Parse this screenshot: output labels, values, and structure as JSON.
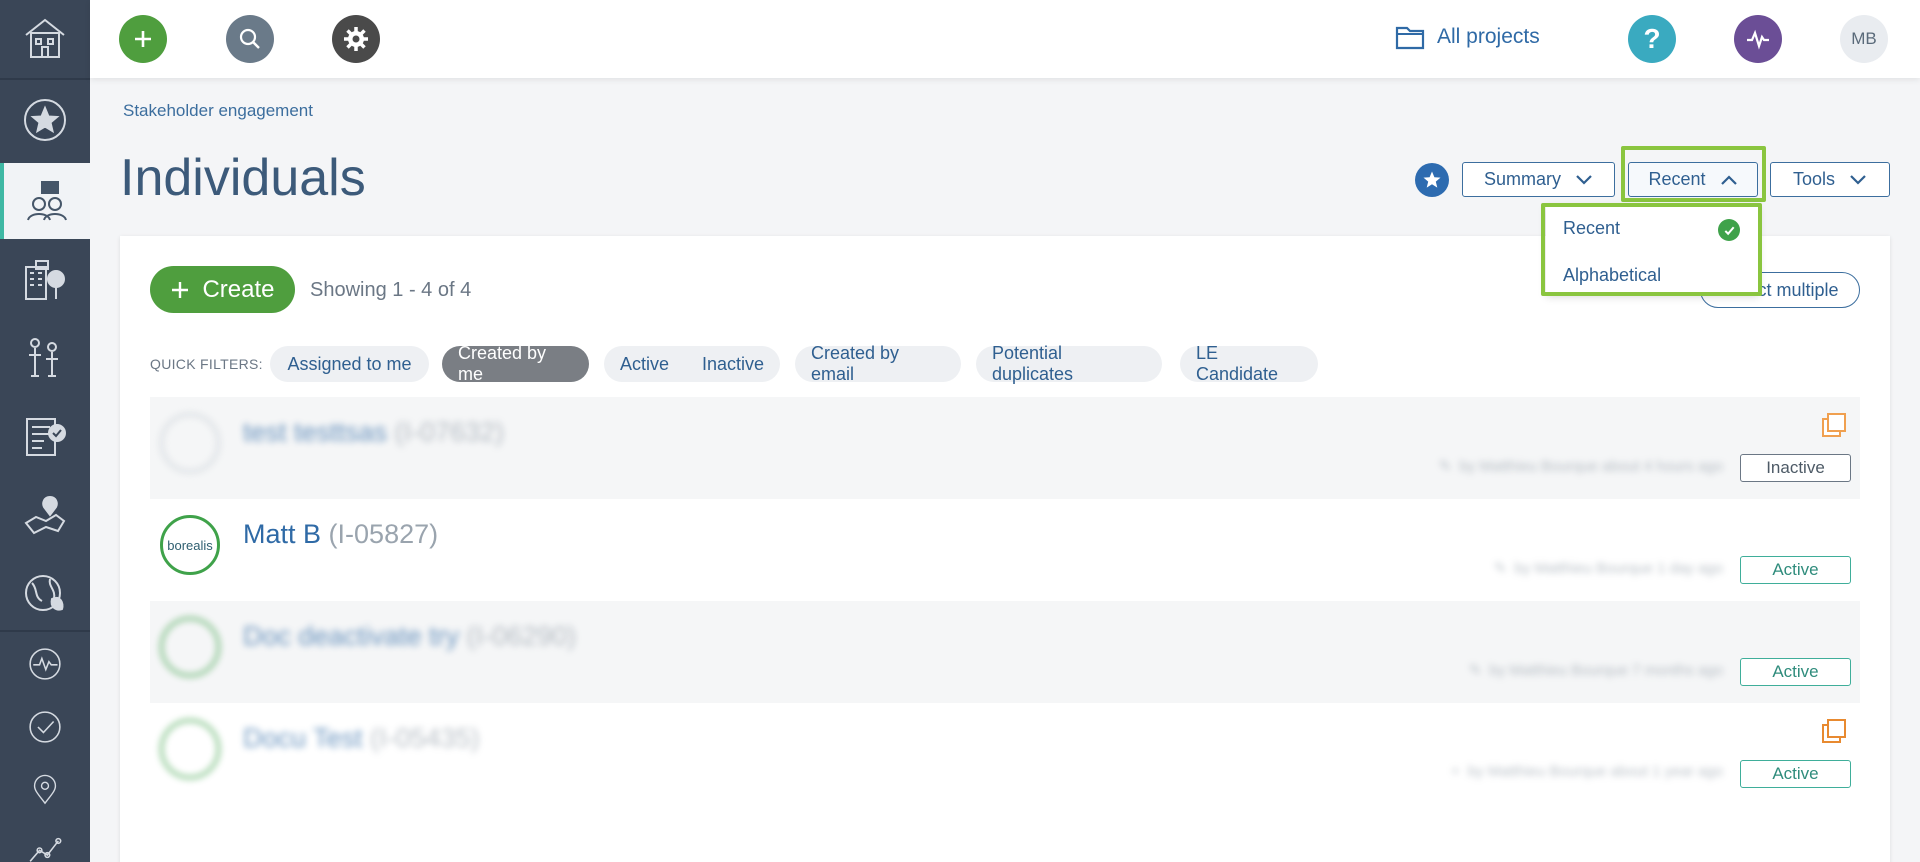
{
  "topbar": {
    "all_projects_label": "All projects",
    "user_initials": "MB",
    "colors": {
      "add": "#4f9e3e",
      "search": "#6a7a89",
      "settings": "#4a4a4a",
      "help": "#3aaac0",
      "activity": "#6b4e96"
    }
  },
  "breadcrumb": "Stakeholder engagement",
  "page_title": "Individuals",
  "toolbar": {
    "summary_label": "Summary",
    "sort_label": "Recent",
    "tools_label": "Tools"
  },
  "sort_menu": {
    "items": [
      {
        "label": "Recent",
        "selected": true
      },
      {
        "label": "Alphabetical",
        "selected": false
      }
    ]
  },
  "list": {
    "create_label": "Create",
    "showing_text": "Showing 1 - 4 of 4",
    "select_multiple_label": "Select multiple",
    "quick_filters_label": "QUICK FILTERS:",
    "filters": [
      {
        "label": "Assigned to me"
      },
      {
        "label": "Created by me",
        "selected": true
      },
      {
        "label": "Active"
      },
      {
        "label": "Inactive"
      },
      {
        "label": "Created by email"
      },
      {
        "label": "Potential duplicates"
      },
      {
        "label": "LE Candidate"
      }
    ],
    "rows": [
      {
        "name": "test testtsas",
        "code": "(I-07632)",
        "meta": "by Matthieu Bourque about 4 hours ago",
        "status": "Inactive"
      },
      {
        "name": "Matt B",
        "code": "(I-05827)",
        "meta": "by Matthieu Bourque 1 day ago",
        "status": "Active",
        "avatar_text": "borealis"
      },
      {
        "name": "Doc deactivate try",
        "code": "(I-06290)",
        "meta": "by Matthieu Bourque 7 months ago",
        "status": "Active"
      },
      {
        "name": "Docu Test",
        "code": "(I-05435)",
        "meta": "by Matthieu Bourque about 1 year ago",
        "status": "Active"
      }
    ]
  }
}
